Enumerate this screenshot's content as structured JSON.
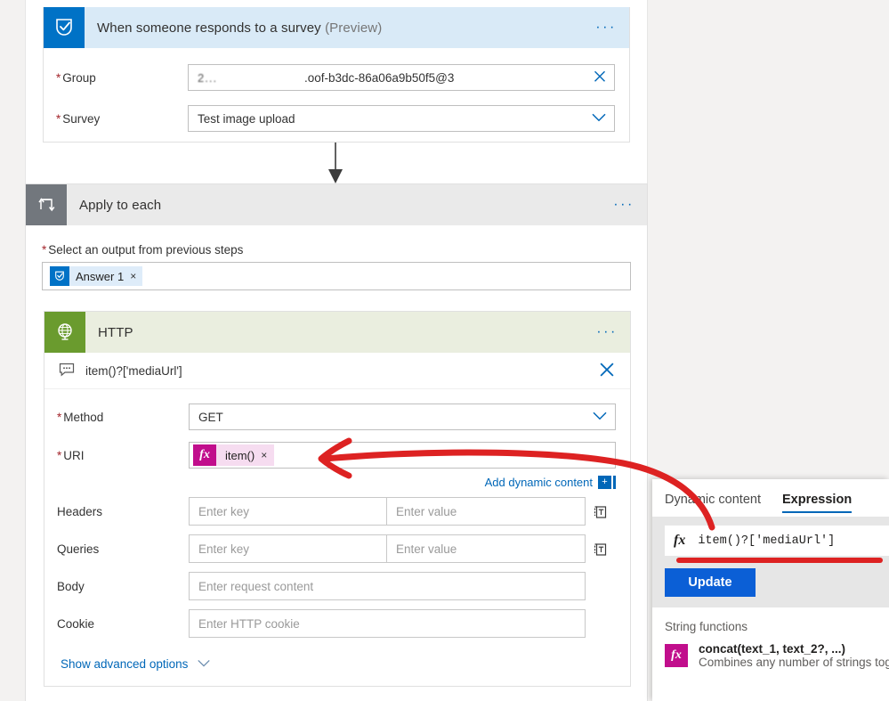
{
  "trigger": {
    "title": "When someone responds to a survey",
    "title_suffix": "(Preview)",
    "icon": "forms-shield-check-icon",
    "menu": "···",
    "fields": [
      {
        "label": "Group",
        "required": true,
        "value_redacted": "2...",
        "value": ".oof-b3dc-86a06a9b50f5@3",
        "affix": "clear-icon"
      },
      {
        "label": "Survey",
        "required": true,
        "value": "Test image upload",
        "affix": "chevron-down-icon"
      }
    ]
  },
  "loop": {
    "title": "Apply to each",
    "icon": "loop-icon",
    "menu": "···",
    "field_label": "Select an output from previous steps",
    "field_required": true,
    "token": {
      "label": "Answer 1",
      "icon": "forms-shield-check-icon",
      "remove": "×"
    }
  },
  "http": {
    "title": "HTTP",
    "icon": "globe-icon",
    "menu": "···",
    "comment": "item()?['mediaUrl']",
    "comment_icon": "comment-icon",
    "comment_clear": "clear-icon",
    "method": {
      "label": "Method",
      "required": true,
      "value": "GET",
      "affix": "chevron-down-icon"
    },
    "uri": {
      "label": "URI",
      "required": true,
      "token_label": "item()",
      "token_fx": "fx",
      "token_remove": "×"
    },
    "add_dynamic_content": "Add dynamic content",
    "add_dynamic_plus": "+",
    "headers": {
      "label": "Headers",
      "key_placeholder": "Enter key",
      "value_placeholder": "Enter value",
      "add_icon": "add-row-icon"
    },
    "queries": {
      "label": "Queries",
      "key_placeholder": "Enter key",
      "value_placeholder": "Enter value",
      "add_icon": "add-row-icon"
    },
    "body": {
      "label": "Body",
      "placeholder": "Enter request content"
    },
    "cookie": {
      "label": "Cookie",
      "placeholder": "Enter HTTP cookie"
    },
    "advanced": {
      "label": "Show advanced options",
      "icon": "chevron-down-icon"
    }
  },
  "flyout": {
    "tabs": [
      {
        "label": "Dynamic content",
        "active": false
      },
      {
        "label": "Expression",
        "active": true
      }
    ],
    "expression": {
      "fx": "fx",
      "value": "item()?['mediaUrl']"
    },
    "update_label": "Update",
    "section_title": "String functions",
    "functions": [
      {
        "icon": "fx",
        "name": "concat(text_1, text_2?, ...)",
        "description": "Combines any number of strings tog"
      }
    ]
  },
  "colors": {
    "trigger_header": "#d9eaf7",
    "trigger_icon": "#0072c6",
    "loop_header": "#eaeaea",
    "loop_icon": "#72777d",
    "http_header": "#eaeedf",
    "http_icon": "#6a9b2e",
    "accent_link": "#0067b8",
    "expression_magenta": "#c10e8c",
    "update_button": "#0b5fd6",
    "annotation_red": "#dd2222",
    "required_star": "#a4262c"
  }
}
